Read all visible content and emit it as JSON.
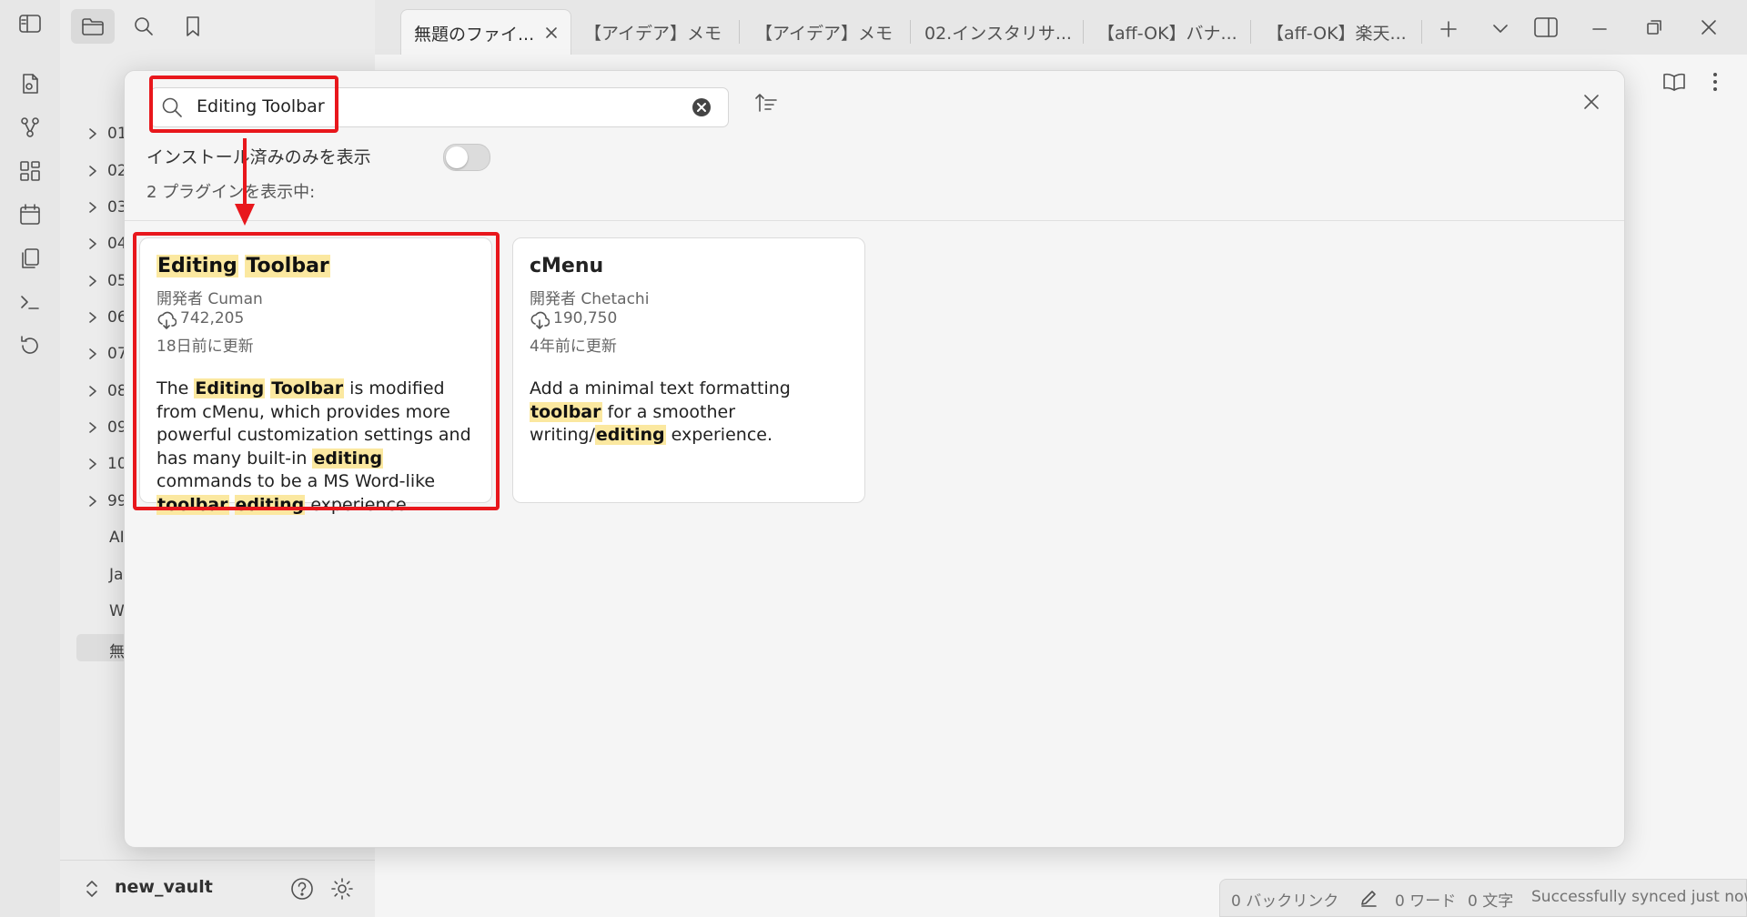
{
  "tabs": [
    {
      "label": "無題のファイ..."
    },
    {
      "label": "【アイデア】メモ"
    },
    {
      "label": "【アイデア】メモ"
    },
    {
      "label": "02.インスタリサ..."
    },
    {
      "label": "【aff-OK】バナ..."
    },
    {
      "label": "【aff-OK】楽天..."
    }
  ],
  "sidebar": {
    "folders": [
      "01",
      "02",
      "03",
      "04",
      "05",
      "06",
      "07",
      "08",
      "09",
      "10",
      "99"
    ],
    "files": [
      "AI",
      "Ja",
      "W"
    ],
    "active_file": "無",
    "vault_name": "new_vault"
  },
  "modal": {
    "search_value": "Editing Toolbar",
    "toggle_label": "インストール済みのみを表示",
    "toggle_on": false,
    "count_text": "2 プラグインを表示中:",
    "plugins": [
      {
        "name_parts": [
          "Editing",
          "Toolbar"
        ],
        "author": "開発者 Cuman",
        "downloads": "742,205",
        "updated": "18日前に更新"
      },
      {
        "name": "cMenu",
        "author": "開発者 Chetachi",
        "downloads": "190,750",
        "updated": "4年前に更新"
      }
    ],
    "desc1": {
      "p1": "The ",
      "h1": "Editing",
      "h2": "Toolbar",
      "p2": " is modified from cMenu, which provides more powerful customization settings and has many built-in ",
      "h3": "editing",
      "p3": " commands to be a MS Word-like ",
      "h4": "toolbar",
      "h5": "editing",
      "p4": " experience."
    },
    "desc2": {
      "p1": "Add a minimal text formatting ",
      "h1": "toolbar",
      "p2": " for a smoother writing/",
      "h2": "editing",
      "p3": " experience."
    }
  },
  "status": {
    "backlinks": "0 バックリンク",
    "words": "0 ワード",
    "chars": "0 文字",
    "sync": "Successfully synced just now"
  },
  "colors": {
    "annotation_red": "#e8171c",
    "highlight": "#fbe8a0"
  }
}
